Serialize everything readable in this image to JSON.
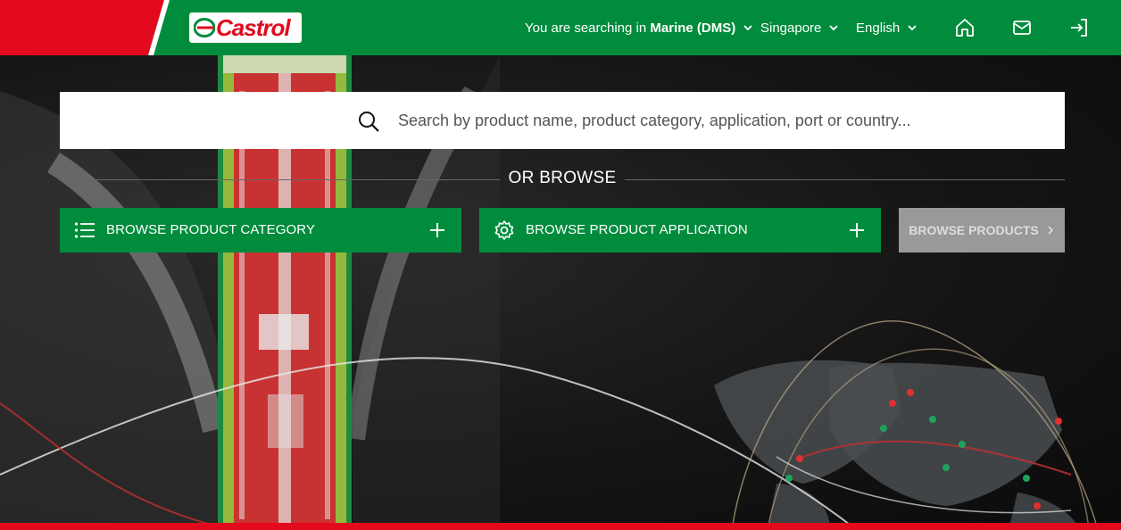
{
  "header": {
    "brand": "Castrol",
    "search_context_prefix": "You are searching in ",
    "search_context_value": "Marine (DMS)",
    "region": "Singapore",
    "language": "English",
    "icons": [
      "home-icon",
      "mail-icon",
      "sign-in-icon"
    ],
    "colors": {
      "green": "#008c3c",
      "red": "#e30a1e"
    }
  },
  "search": {
    "placeholder": "Search by product name, product category, application, port or country..."
  },
  "browse": {
    "divider_label": "OR BROWSE",
    "category_label": "BROWSE PRODUCT CATEGORY",
    "application_label": "BROWSE PRODUCT APPLICATION",
    "products_label": "BROWSE PRODUCTS"
  }
}
